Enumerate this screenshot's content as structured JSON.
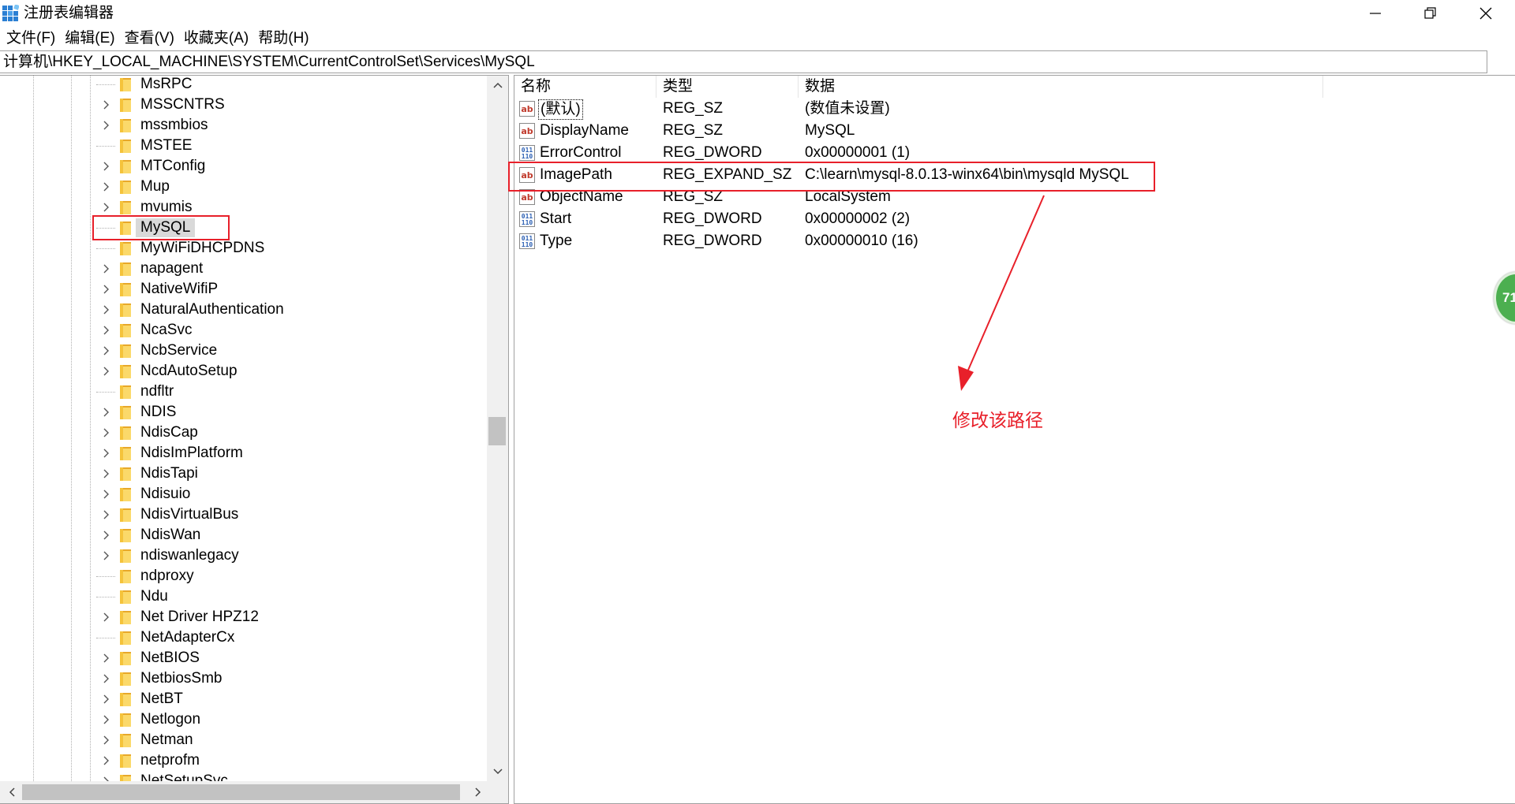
{
  "window": {
    "title": "注册表编辑器",
    "controls": {
      "minimize": "minimize-icon",
      "maximize": "restore-icon",
      "close": "close-icon"
    }
  },
  "menu": [
    "文件(F)",
    "编辑(E)",
    "查看(V)",
    "收藏夹(A)",
    "帮助(H)"
  ],
  "address": "计算机\\HKEY_LOCAL_MACHINE\\SYSTEM\\CurrentControlSet\\Services\\MySQL",
  "tree": {
    "items": [
      {
        "label": "MsRPC",
        "expandable": false
      },
      {
        "label": "MSSCNTRS",
        "expandable": true
      },
      {
        "label": "mssmbios",
        "expandable": true
      },
      {
        "label": "MSTEE",
        "expandable": false
      },
      {
        "label": "MTConfig",
        "expandable": true
      },
      {
        "label": "Mup",
        "expandable": true
      },
      {
        "label": "mvumis",
        "expandable": true
      },
      {
        "label": "MySQL",
        "expandable": false,
        "selected": true
      },
      {
        "label": "MyWiFiDHCPDNS",
        "expandable": false
      },
      {
        "label": "napagent",
        "expandable": true
      },
      {
        "label": "NativeWifiP",
        "expandable": true
      },
      {
        "label": "NaturalAuthentication",
        "expandable": true
      },
      {
        "label": "NcaSvc",
        "expandable": true
      },
      {
        "label": "NcbService",
        "expandable": true
      },
      {
        "label": "NcdAutoSetup",
        "expandable": true
      },
      {
        "label": "ndfltr",
        "expandable": false
      },
      {
        "label": "NDIS",
        "expandable": true
      },
      {
        "label": "NdisCap",
        "expandable": true
      },
      {
        "label": "NdisImPlatform",
        "expandable": true
      },
      {
        "label": "NdisTapi",
        "expandable": true
      },
      {
        "label": "Ndisuio",
        "expandable": true
      },
      {
        "label": "NdisVirtualBus",
        "expandable": true
      },
      {
        "label": "NdisWan",
        "expandable": true
      },
      {
        "label": "ndiswanlegacy",
        "expandable": true
      },
      {
        "label": "ndproxy",
        "expandable": false
      },
      {
        "label": "Ndu",
        "expandable": false
      },
      {
        "label": "Net Driver HPZ12",
        "expandable": true
      },
      {
        "label": "NetAdapterCx",
        "expandable": false
      },
      {
        "label": "NetBIOS",
        "expandable": true
      },
      {
        "label": "NetbiosSmb",
        "expandable": true
      },
      {
        "label": "NetBT",
        "expandable": true
      },
      {
        "label": "Netlogon",
        "expandable": true
      },
      {
        "label": "Netman",
        "expandable": true
      },
      {
        "label": "netprofm",
        "expandable": true
      },
      {
        "label": "NetSetupSvc",
        "expandable": true
      }
    ]
  },
  "values": {
    "columns": {
      "name": "名称",
      "type": "类型",
      "data": "数据"
    },
    "rows": [
      {
        "icon": "string-value-icon",
        "name": "(默认)",
        "type": "REG_SZ",
        "data": "(数值未设置)"
      },
      {
        "icon": "string-value-icon",
        "name": "DisplayName",
        "type": "REG_SZ",
        "data": "MySQL"
      },
      {
        "icon": "binary-value-icon",
        "name": "ErrorControl",
        "type": "REG_DWORD",
        "data": "0x00000001 (1)"
      },
      {
        "icon": "string-value-icon",
        "name": "ImagePath",
        "type": "REG_EXPAND_SZ",
        "data": "C:\\learn\\mysql-8.0.13-winx64\\bin\\mysqld MySQL"
      },
      {
        "icon": "string-value-icon",
        "name": "ObjectName",
        "type": "REG_SZ",
        "data": "LocalSystem"
      },
      {
        "icon": "binary-value-icon",
        "name": "Start",
        "type": "REG_DWORD",
        "data": "0x00000002 (2)"
      },
      {
        "icon": "binary-value-icon",
        "name": "Type",
        "type": "REG_DWORD",
        "data": "0x00000010 (16)"
      }
    ]
  },
  "annotation": {
    "text": "修改该路径",
    "color": "#e8202a"
  },
  "badge": {
    "text": "71",
    "color": "#4caf50"
  },
  "colors": {
    "highlight_box": "#e8202a",
    "selection": "#d9d9d9",
    "folder": "#f5c33b"
  }
}
